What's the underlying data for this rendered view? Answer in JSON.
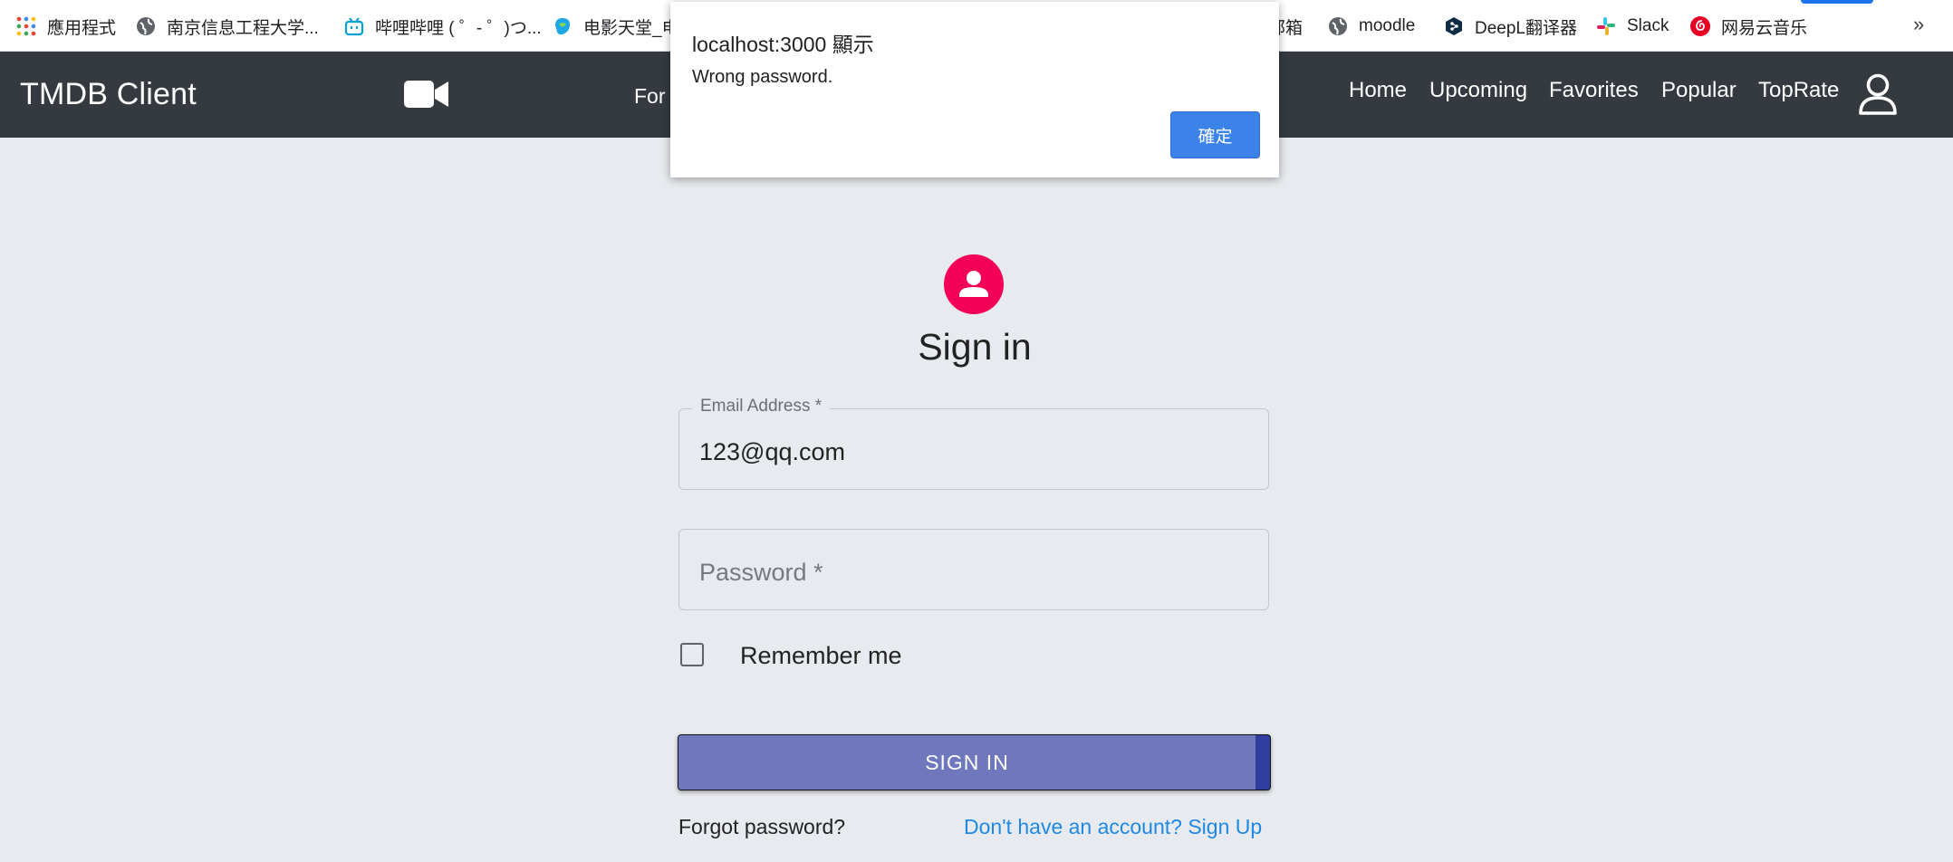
{
  "bookmarks": {
    "items": [
      {
        "label": "應用程式",
        "icon": "apps-grid-icon"
      },
      {
        "label": "南京信息工程大学...",
        "icon": "globe-icon"
      },
      {
        "label": "哔哩哔哩 ( ゜- ゜)つ...",
        "icon": "bilibili-icon"
      },
      {
        "label": "电影天堂_电",
        "icon": "movie-site-icon"
      },
      {
        "label": "邮箱",
        "icon": "mail-site-icon"
      },
      {
        "label": "moodle",
        "icon": "globe-icon"
      },
      {
        "label": "DeepL翻译器",
        "icon": "deepl-icon"
      },
      {
        "label": "Slack",
        "icon": "slack-icon"
      },
      {
        "label": "网易云音乐",
        "icon": "netease-music-icon"
      }
    ],
    "overflow_glyph": "»"
  },
  "appbar": {
    "title": "TMDB Client",
    "partial_text": "For",
    "nav": [
      "Home",
      "Upcoming",
      "Favorites",
      "Popular",
      "TopRate"
    ]
  },
  "form": {
    "title": "Sign in",
    "email_label": "Email Address *",
    "email_value": "123@qq.com",
    "password_placeholder": "Password *",
    "remember_label": "Remember me",
    "remember_checked": false,
    "submit_label": "SIGN IN",
    "forgot_label": "Forgot password?",
    "signup_label": "Don't have an account? Sign Up"
  },
  "dialog": {
    "title": "localhost:3000 顯示",
    "message": "Wrong password.",
    "ok_label": "確定"
  },
  "colors": {
    "appbar_bg": "#343a40",
    "page_bg": "#e7eaee",
    "avatar_bg": "#f50057",
    "button_bg": "#303f9f",
    "link": "#1e88e5",
    "dialog_button": "#3b82e9"
  }
}
